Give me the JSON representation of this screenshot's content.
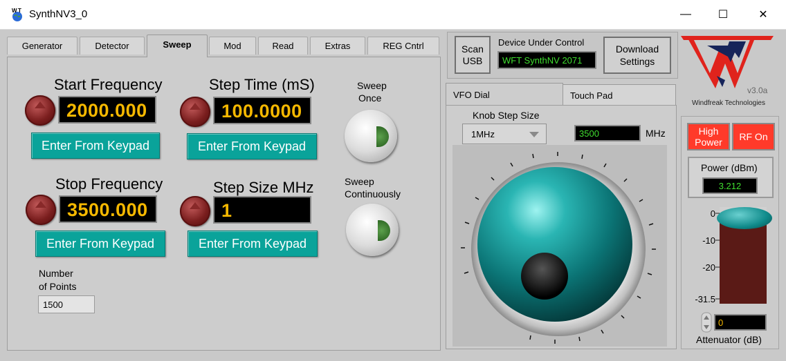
{
  "window": {
    "title": "SynthNV3_0",
    "minimize": "—",
    "maximize": "☐",
    "close": "✕"
  },
  "tabs": [
    {
      "label": "Generator"
    },
    {
      "label": "Detector"
    },
    {
      "label": "Sweep",
      "active": true
    },
    {
      "label": "Mod"
    },
    {
      "label": "Read"
    },
    {
      "label": "Extras"
    },
    {
      "label": "REG Cntrl"
    }
  ],
  "sweep": {
    "start_label": "Start Frequency",
    "start_value": "2000.000",
    "step_time_label": "Step Time (mS)",
    "step_time_value": "100.0000",
    "stop_label": "Stop Frequency",
    "stop_value": "3500.000",
    "step_size_label": "Step Size MHz",
    "step_size_value": "1",
    "keypad_label": "Enter From Keypad",
    "sweep_once_label_1": "Sweep",
    "sweep_once_label_2": "Once",
    "sweep_cont_label_1": "Sweep",
    "sweep_cont_label_2": "Continuously",
    "points_label_1": "Number",
    "points_label_2": "of Points",
    "points_value": "1500"
  },
  "device": {
    "scan_label_1": "Scan",
    "scan_label_2": "USB",
    "duc_label": "Device Under Control",
    "duc_value": "WFT SynthNV 2071",
    "download_label_1": "Download",
    "download_label_2": "Settings"
  },
  "vfo": {
    "tabs": [
      {
        "label": "VFO Dial",
        "active": true
      },
      {
        "label": "Touch Pad"
      }
    ],
    "knob_step_label": "Knob Step Size",
    "knob_step_value": "1MHz",
    "freq_value": "3500",
    "freq_unit": "MHz"
  },
  "logo": {
    "version": "v3.0a",
    "company": "Windfreak Technologies"
  },
  "power": {
    "high_power_1": "High",
    "high_power_2": "Power",
    "rf_on": "RF On",
    "label": "Power (dBm)",
    "value": "3.212",
    "scale": [
      "0",
      "-10",
      "-20",
      "-31.5"
    ],
    "level_fraction": 1.0,
    "attenuator_value": "0",
    "attenuator_label": "Attenuator (dB)"
  },
  "colors": {
    "teal_button": "#0aa39a",
    "digit_amber": "#f5b800",
    "display_green": "#3fde2f",
    "red_button": "#ff3a2a",
    "knob_teal": "#0f8a8a",
    "bar_dark_red": "#5a1a16"
  },
  "icons": {
    "app": "wft-logo-icon",
    "dial": "vfo-knob"
  }
}
